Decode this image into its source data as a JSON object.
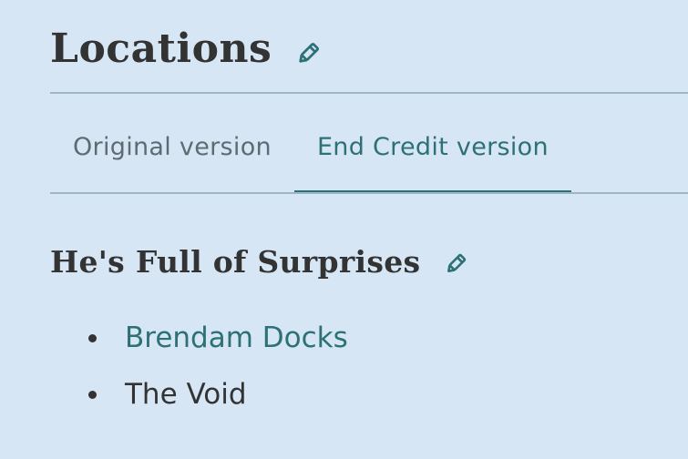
{
  "section": {
    "title": "Locations",
    "edit_icon": "pencil-icon"
  },
  "tabs": [
    {
      "label": "Original version",
      "active": false
    },
    {
      "label": "End Credit version",
      "active": true
    }
  ],
  "episode": {
    "title": "He's Full of Surprises",
    "edit_icon": "pencil-icon",
    "locations": [
      {
        "name": "Brendam Docks",
        "linked": true
      },
      {
        "name": "The Void",
        "linked": false
      }
    ]
  },
  "colors": {
    "background": "#d6e6f5",
    "accent": "#2d7177",
    "text": "#333333",
    "tab_inactive": "#5e6b73",
    "divider": "#9fb6c9"
  }
}
